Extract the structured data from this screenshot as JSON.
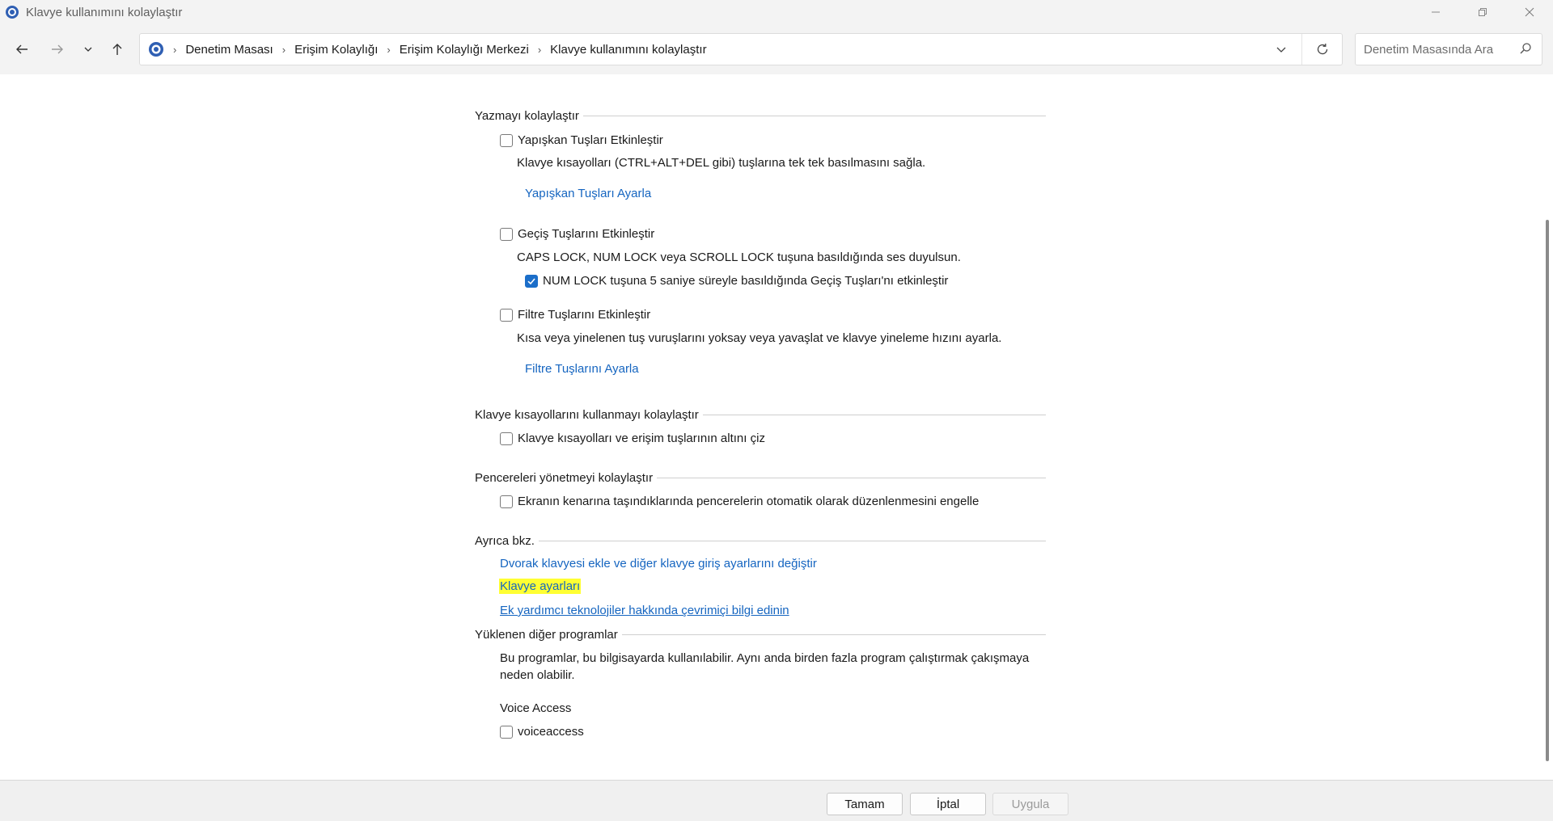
{
  "window": {
    "title": "Klavye kullanımını kolaylaştır"
  },
  "address": {
    "breadcrumbs": [
      "Denetim Masası",
      "Erişim Kolaylığı",
      "Erişim Kolaylığı Merkezi",
      "Klavye kullanımını kolaylaştır"
    ]
  },
  "search": {
    "placeholder": "Denetim Masasında Ara"
  },
  "sections": {
    "typing": {
      "title": "Yazmayı kolaylaştır",
      "sticky": {
        "label": "Yapışkan Tuşları Etkinleştir",
        "checked": false,
        "desc": "Klavye kısayolları (CTRL+ALT+DEL gibi) tuşlarına tek tek basılmasını sağla.",
        "link": "Yapışkan Tuşları Ayarla"
      },
      "toggle": {
        "label": "Geçiş Tuşlarını Etkinleştir",
        "checked": false,
        "desc": "CAPS LOCK, NUM LOCK veya SCROLL LOCK tuşuna basıldığında ses duyulsun.",
        "sub_label": "NUM LOCK tuşuna 5 saniye süreyle basıldığında Geçiş Tuşları'nı etkinleştir",
        "sub_checked": true
      },
      "filter": {
        "label": "Filtre Tuşlarını Etkinleştir",
        "checked": false,
        "desc": "Kısa veya yinelenen tuş vuruşlarını yoksay veya yavaşlat ve klavye yineleme hızını ayarla.",
        "link": "Filtre Tuşlarını Ayarla"
      }
    },
    "shortcuts": {
      "title": "Klavye kısayollarını kullanmayı kolaylaştır",
      "underline": {
        "label": "Klavye kısayolları ve erişim tuşlarının altını çiz",
        "checked": false
      }
    },
    "windows": {
      "title": "Pencereleri yönetmeyi kolaylaştır",
      "snap": {
        "label": "Ekranın kenarına taşındıklarında pencerelerin otomatik olarak düzenlenmesini engelle",
        "checked": false
      }
    },
    "see_also": {
      "title": "Ayrıca bkz.",
      "links": [
        "Dvorak klavyesi ekle ve diğer klavye giriş ayarlarını değiştir",
        "Klavye ayarları",
        "Ek yardımcı teknolojiler hakkında çevrimiçi bilgi edinin"
      ]
    },
    "other_programs": {
      "title": "Yüklenen diğer programlar",
      "desc": "Bu programlar, bu bilgisayarda kullanılabilir. Aynı anda birden fazla program çalıştırmak çakışmaya neden olabilir.",
      "group_title": "Voice Access",
      "program": {
        "label": "voiceaccess",
        "checked": false
      }
    }
  },
  "footer": {
    "ok": "Tamam",
    "cancel": "İptal",
    "apply": "Uygula"
  },
  "colors": {
    "link": "#1565c0",
    "highlight": "#ffff33",
    "check_accent": "#1b6ec9"
  }
}
